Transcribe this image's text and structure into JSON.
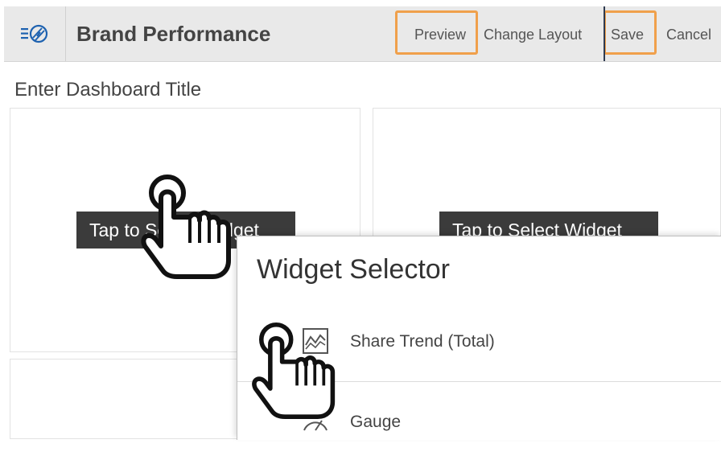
{
  "header": {
    "menu_icon": "menu-logo-icon",
    "title": "Brand Performance",
    "buttons": {
      "preview": "Preview",
      "change_layout": "Change Layout",
      "save": "Save",
      "cancel": "Cancel"
    },
    "highlight_color": "#f0a04b"
  },
  "dashboard": {
    "title_placeholder": "Enter Dashboard Title",
    "tiles": [
      {
        "label": "Tap to Select Widget"
      },
      {
        "label": "Tap to Select Widget"
      }
    ]
  },
  "widget_selector": {
    "title": "Widget Selector",
    "items": [
      {
        "label": "Share Trend (Total)",
        "icon": "line-chart-icon"
      },
      {
        "label": "Gauge",
        "icon": "gauge-icon"
      }
    ]
  },
  "colors": {
    "header_bg": "#e9e9e9",
    "tile_label_bg": "#3b3b3b",
    "accent_blue": "#1e62b0"
  }
}
